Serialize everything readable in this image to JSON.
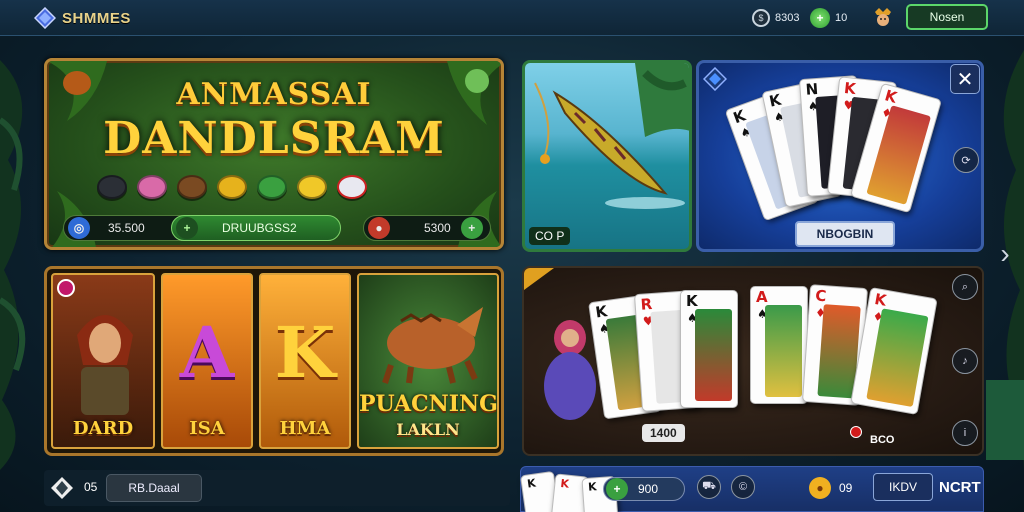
{
  "header": {
    "logo_text": "SHMMES",
    "coins_value": "8303",
    "gems_value": "10",
    "login_label": "Nosen"
  },
  "promo": {
    "title_line1": "ANMASSAI",
    "title_line2": "DANDLSRAM",
    "left_value": "35.500",
    "center_label": "DRUUBGSS2",
    "right_value": "5300"
  },
  "fishing_tile": {
    "label": "CO P"
  },
  "blue_cards_tile": {
    "button_label": "NBOGBIN"
  },
  "slots": {
    "tiles": [
      {
        "label": "DARD"
      },
      {
        "label": "ISA"
      },
      {
        "label": "HMA"
      },
      {
        "label": "PUACNING",
        "sublabel": "LAKLN"
      }
    ]
  },
  "poker_tile": {
    "pot_label": "1400",
    "bet_label": "BCO"
  },
  "bottom_left": {
    "count": "05",
    "button_label": "RB.Daaal"
  },
  "bottom_right": {
    "gem_value": "900",
    "coin_value": "09",
    "button_label": "IKDV",
    "side_label": "NCRT"
  },
  "icons": {
    "close": "close-icon",
    "next": "chevron-right-icon"
  },
  "colors": {
    "accent_gold": "#ffd23c",
    "accent_green": "#5cd66a",
    "card_red": "#d21b1b"
  }
}
